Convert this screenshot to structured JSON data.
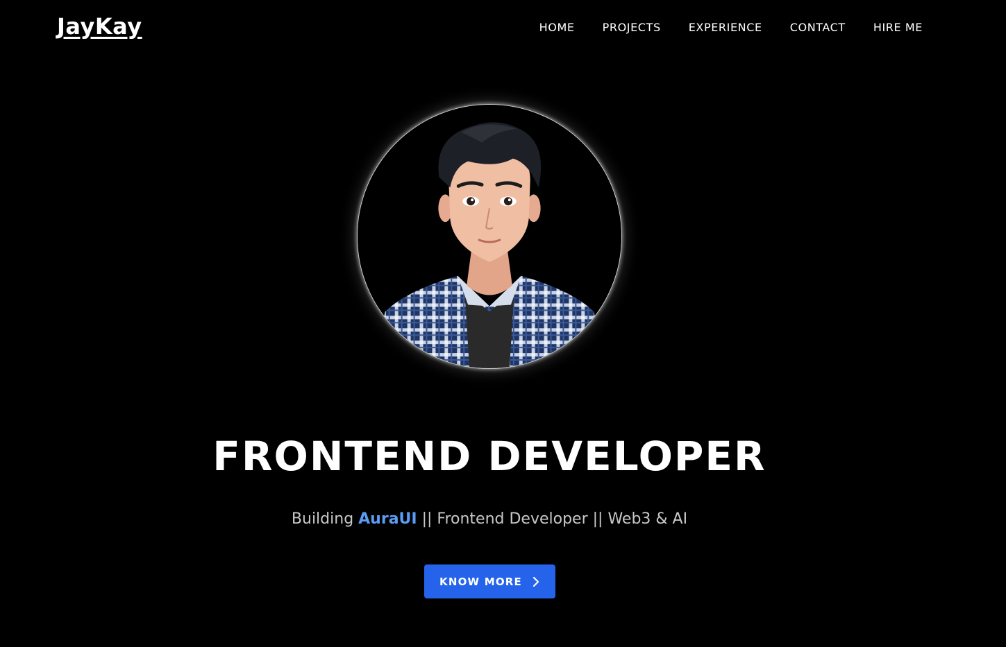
{
  "header": {
    "logo": "JayKay",
    "nav": [
      {
        "label": "HOME"
      },
      {
        "label": "PROJECTS"
      },
      {
        "label": "EXPERIENCE"
      },
      {
        "label": "CONTACT"
      },
      {
        "label": "HIRE ME"
      }
    ]
  },
  "hero": {
    "avatar_icon": "profile-avatar",
    "headline": "FRONTEND DEVELOPER",
    "tagline": {
      "prefix": "Building ",
      "highlight": "AuraUI",
      "suffix": " || Frontend Developer || Web3 & AI"
    },
    "cta_label": "KNOW MORE",
    "cta_icon": "chevron-right-icon"
  },
  "colors": {
    "background": "#000000",
    "accent": "#5b9cf5",
    "button": "#2563eb",
    "text": "#ffffff",
    "muted": "#c8c8c8"
  }
}
